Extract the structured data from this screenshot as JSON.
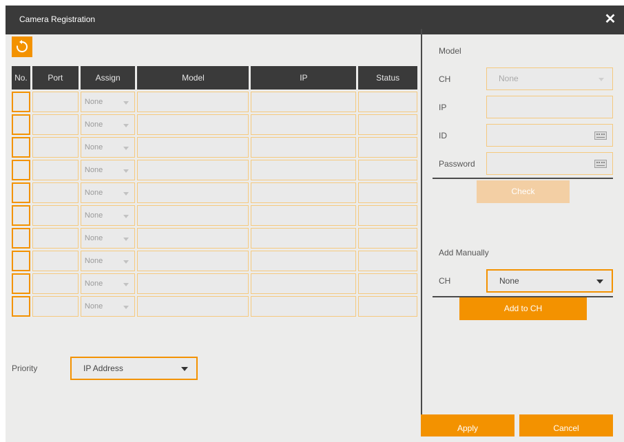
{
  "dialog": {
    "title": "Camera Registration",
    "close_glyph": "✕"
  },
  "toolbar": {
    "refresh_icon": "refresh-icon"
  },
  "table": {
    "headers": [
      "No.",
      "Port",
      "Assign",
      "Model",
      "IP",
      "Status"
    ],
    "rows": [
      {
        "assign": "None"
      },
      {
        "assign": "None"
      },
      {
        "assign": "None"
      },
      {
        "assign": "None"
      },
      {
        "assign": "None"
      },
      {
        "assign": "None"
      },
      {
        "assign": "None"
      },
      {
        "assign": "None"
      },
      {
        "assign": "None"
      },
      {
        "assign": "None"
      }
    ]
  },
  "priority": {
    "label": "Priority",
    "value": "IP Address"
  },
  "model_panel": {
    "heading": "Model",
    "ch_label": "CH",
    "ch_value": "None",
    "ip_label": "IP",
    "ip_value": "",
    "id_label": "ID",
    "id_value": "",
    "password_label": "Password",
    "password_value": "",
    "check_label": "Check"
  },
  "manual_panel": {
    "heading": "Add Manually",
    "ch_label": "CH",
    "ch_value": "None",
    "add_label": "Add to CH"
  },
  "footer": {
    "apply_label": "Apply",
    "cancel_label": "Cancel"
  },
  "colors": {
    "accent": "#f39200",
    "accent_disabled": "#f3cfa4",
    "titlebar": "#3a3a3a",
    "panel": "#ececeb"
  }
}
